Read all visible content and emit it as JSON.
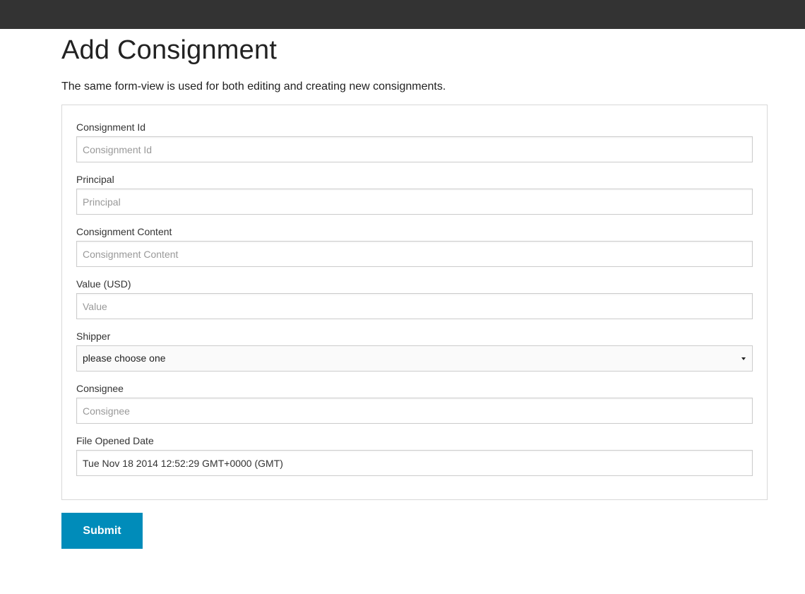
{
  "page": {
    "title": "Add Consignment",
    "description": "The same form-view is used for both editing and creating new consignments."
  },
  "form": {
    "consignment_id": {
      "label": "Consignment Id",
      "placeholder": "Consignment Id",
      "value": ""
    },
    "principal": {
      "label": "Principal",
      "placeholder": "Principal",
      "value": ""
    },
    "consignment_content": {
      "label": "Consignment Content",
      "placeholder": "Consignment Content",
      "value": ""
    },
    "value_usd": {
      "label": "Value (USD)",
      "placeholder": "Value",
      "value": ""
    },
    "shipper": {
      "label": "Shipper",
      "selected": "please choose one"
    },
    "consignee": {
      "label": "Consignee",
      "placeholder": "Consignee",
      "value": ""
    },
    "file_opened_date": {
      "label": "File Opened Date",
      "value": "Tue Nov 18 2014 12:52:29 GMT+0000 (GMT)"
    },
    "submit_label": "Submit"
  },
  "colors": {
    "topbar": "#333333",
    "accent": "#008cba",
    "panel_border": "#d8d8d8"
  },
  "icons": {
    "select_caret": "chevron-down-icon"
  }
}
